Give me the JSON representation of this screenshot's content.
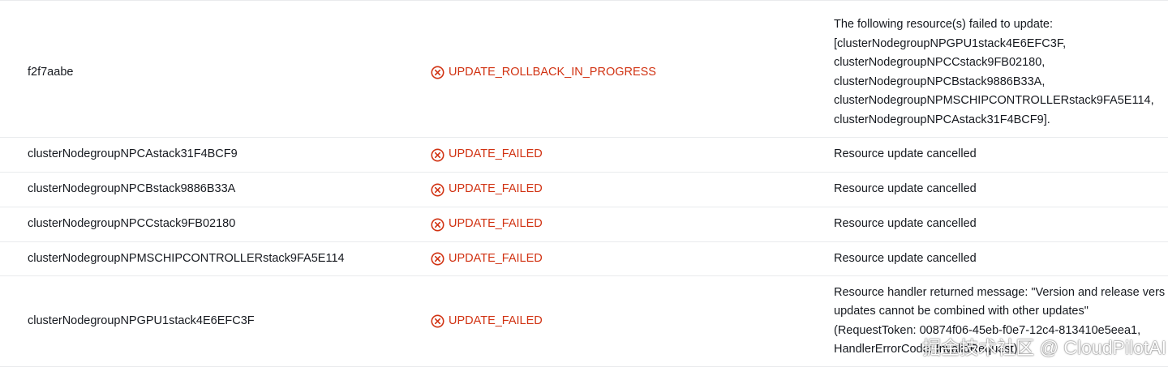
{
  "colors": {
    "failed": "#d13212",
    "text": "#16191f",
    "divider": "#e9ebed"
  },
  "status_icon": "x-circle-icon",
  "rows": [
    {
      "logical_id": "f2f7aabe",
      "status": "UPDATE_ROLLBACK_IN_PROGRESS",
      "reason_lines": [
        "The following resource(s) failed to update:",
        "[clusterNodegroupNPGPU1stack4E6EFC3F,",
        "clusterNodegroupNPCCstack9FB02180,",
        "clusterNodegroupNPCBstack9886B33A,",
        "clusterNodegroupNPMSCHIPCONTROLLERstack9FA5E114,",
        "clusterNodegroupNPCAstack31F4BCF9]."
      ]
    },
    {
      "logical_id": "clusterNodegroupNPCAstack31F4BCF9",
      "status": "UPDATE_FAILED",
      "reason_lines": [
        "Resource update cancelled"
      ]
    },
    {
      "logical_id": "clusterNodegroupNPCBstack9886B33A",
      "status": "UPDATE_FAILED",
      "reason_lines": [
        "Resource update cancelled"
      ]
    },
    {
      "logical_id": "clusterNodegroupNPCCstack9FB02180",
      "status": "UPDATE_FAILED",
      "reason_lines": [
        "Resource update cancelled"
      ]
    },
    {
      "logical_id": "clusterNodegroupNPMSCHIPCONTROLLERstack9FA5E114",
      "status": "UPDATE_FAILED",
      "reason_lines": [
        "Resource update cancelled"
      ]
    },
    {
      "logical_id": "clusterNodegroupNPGPU1stack4E6EFC3F",
      "status": "UPDATE_FAILED",
      "reason_lines": [
        "Resource handler returned message: \"Version and release vers",
        "updates cannot be combined with other updates\"",
        "(RequestToken: 00874f06-45eb-f0e7-12c4-813410e5eea1,",
        "HandlerErrorCode: InvalidRequest)"
      ]
    }
  ],
  "watermark": "掘金技术社区 @ CloudPilotAI"
}
